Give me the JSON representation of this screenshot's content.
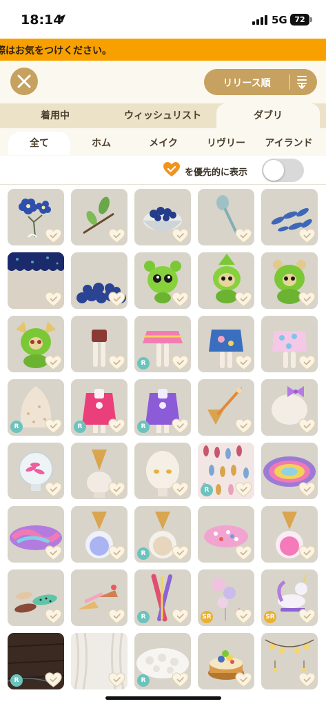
{
  "status": {
    "time": "18:14",
    "network": "5G",
    "battery": "72"
  },
  "notice": {
    "text": "際はお気をつけください。"
  },
  "header": {
    "sort_label": "リリース順"
  },
  "tabs": [
    {
      "label": "着用中"
    },
    {
      "label": "ウィッシュリスト"
    },
    {
      "label": "ダブリ"
    }
  ],
  "subtabs": [
    {
      "label": "全て"
    },
    {
      "label": "ホム"
    },
    {
      "label": "メイク"
    },
    {
      "label": "リヴリー"
    },
    {
      "label": "アイランド"
    }
  ],
  "filter": {
    "label": "を優先的に表示",
    "enabled": false
  },
  "colors": {
    "accent": "#c6a15f",
    "notice": "#f7a000",
    "tab_bg": "#ebe2c8",
    "card_bg": "#d8d4c9",
    "rarity_r": "#6cc3bd",
    "rarity_sr": "#eab132"
  },
  "items": [
    {
      "icon": "blue-flower",
      "rarity": ""
    },
    {
      "icon": "green-sprig",
      "rarity": ""
    },
    {
      "icon": "berry-bowl",
      "rarity": ""
    },
    {
      "icon": "spoon",
      "rarity": ""
    },
    {
      "icon": "blue-petals",
      "rarity": ""
    },
    {
      "icon": "night-wallpaper",
      "rarity": ""
    },
    {
      "icon": "berry-pile",
      "rarity": ""
    },
    {
      "icon": "green-creature",
      "rarity": ""
    },
    {
      "icon": "green-creature-hat",
      "rarity": ""
    },
    {
      "icon": "green-creature-ears",
      "rarity": ""
    },
    {
      "icon": "green-creature-yellow-ears",
      "rarity": ""
    },
    {
      "icon": "brown-shorts",
      "rarity": ""
    },
    {
      "icon": "pink-tutu",
      "rarity": "R"
    },
    {
      "icon": "blue-shirt",
      "rarity": ""
    },
    {
      "icon": "pastel-shirt",
      "rarity": ""
    },
    {
      "icon": "beige-hat",
      "rarity": "R"
    },
    {
      "icon": "pink-apron-dress",
      "rarity": "R"
    },
    {
      "icon": "purple-apron-dress",
      "rarity": "R"
    },
    {
      "icon": "ice-cream-spoon",
      "rarity": ""
    },
    {
      "icon": "bow-hat",
      "rarity": ""
    },
    {
      "icon": "candy-jar",
      "rarity": ""
    },
    {
      "icon": "cone-hat",
      "rarity": ""
    },
    {
      "icon": "yellow-eyes",
      "rarity": ""
    },
    {
      "icon": "cookie-pattern",
      "rarity": "R"
    },
    {
      "icon": "rainbow-rug",
      "rarity": ""
    },
    {
      "icon": "swirl-rug",
      "rarity": ""
    },
    {
      "icon": "cone-jar-blue",
      "rarity": ""
    },
    {
      "icon": "cone-jar-beige",
      "rarity": "R"
    },
    {
      "icon": "pink-dots-rug",
      "rarity": ""
    },
    {
      "icon": "cone-jar-pink",
      "rarity": ""
    },
    {
      "icon": "chocolate-bars",
      "rarity": ""
    },
    {
      "icon": "cone-sticks",
      "rarity": ""
    },
    {
      "icon": "pencil-sticks",
      "rarity": "R"
    },
    {
      "icon": "bubble-lamp",
      "rarity": "SR"
    },
    {
      "icon": "unicorn-toy",
      "rarity": "SR"
    },
    {
      "icon": "dark-wood-floor",
      "rarity": "R"
    },
    {
      "icon": "white-curtain",
      "rarity": ""
    },
    {
      "icon": "fluffy-rug",
      "rarity": "R"
    },
    {
      "icon": "fruit-tart",
      "rarity": ""
    },
    {
      "icon": "string-lights",
      "rarity": ""
    }
  ]
}
